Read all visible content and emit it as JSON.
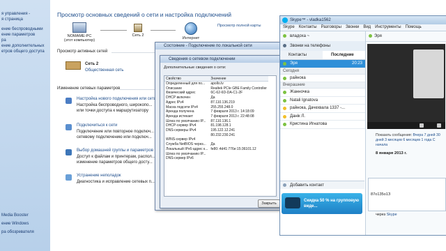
{
  "leftnav": {
    "items": [
      "я управления -",
      "я страница",
      "ение беспроводными",
      "ение параметров",
      "ра",
      "ение дополнительных",
      "етров общего доступа"
    ],
    "bottom": [
      "Media Booster",
      "ение Windows",
      "ра обозревателя"
    ]
  },
  "main": {
    "title": "Просмотр основных сведений о сети и настройка подключений",
    "view_full_map": "Просмотр полной карты",
    "nodes": [
      {
        "label": "NOMAME-PC",
        "sub": "(этот компьютер)"
      },
      {
        "label": "Сеть 2",
        "sub": ""
      },
      {
        "label": "Интернет",
        "sub": ""
      }
    ],
    "active_networks_title": "Просмотр активных сетей",
    "active_network": {
      "name": "Сеть 2",
      "type": "Общественная сеть"
    },
    "change_settings_title": "Изменение сетевых параметров",
    "settings": [
      {
        "link": "Настройка нового подключения или сети",
        "desc": "Настройка беспроводного, широкопо...",
        "desc2": "или точки доступа к маршрутизатору"
      },
      {
        "link": "Подключиться к сети",
        "desc": "Подключение или повторное подключ...",
        "desc2": "сетевому подключению или подключ..."
      },
      {
        "link": "Выбор домашней группы и параметров",
        "desc": "Доступ к файлам и принтерам, распол...",
        "desc2": "изменение параметров общего досту..."
      },
      {
        "link": "Устранение неполадок",
        "desc": "Диагностика и исправление сетевых п...",
        "desc2": ""
      }
    ]
  },
  "status_dlg": {
    "title": "Состояние - Подключение по локальной сети"
  },
  "details_dlg": {
    "title": "Сведения о сетевом подключении",
    "section": "Дополнительные сведения о сети:",
    "col_prop": "Свойство",
    "col_val": "Значение",
    "rows": [
      [
        "Определенный для по...",
        "apollo.lv"
      ],
      [
        "Описание",
        "Realtek PCIe GBE Family Controller"
      ],
      [
        "Физический адрес",
        "6C-62-6D-DA-C1-2F"
      ],
      [
        "DHCP включен",
        "Да"
      ],
      [
        "Адрес IPv4",
        "87.110.136.219"
      ],
      [
        "Маска подсети IPv4",
        "255.255.248.0"
      ],
      [
        "Аренда получена",
        "7 февраля 2013 г. 14:18:09"
      ],
      [
        "Аренда истекает",
        "7 февраля 2013 г. 22:48:08"
      ],
      [
        "Шлюз по умолчанию IP...",
        "87.110.136.1"
      ],
      [
        "DHCP-сервер IPv4",
        "81.198.128.1"
      ],
      [
        "DNS-серверы IPv4",
        "195.122.12.241"
      ],
      [
        "",
        "80.232.230.241"
      ],
      [
        "WINS-сервер IPv4",
        ""
      ],
      [
        "Служба NetBIOS через...",
        "Да"
      ],
      [
        "Локальный IPv6-адрес к...",
        "fe80::4d41:776e:15:36101.12"
      ],
      [
        "Шлюз по умолчанию IP...",
        ""
      ],
      [
        "DNS-сервер IPv6",
        ""
      ]
    ],
    "close_button": "Закрыть"
  },
  "skype": {
    "title": "Skype™ - vladka1562",
    "menu": [
      "Skype",
      "Контакты",
      "Разговоры",
      "Звонки",
      "Вид",
      "Инструменты",
      "Помощь"
    ],
    "user": "владоха ~",
    "call_phones": "Звонки на телефоны",
    "tab_contacts": "Контакты",
    "tab_recent": "Последние",
    "contacts": [
      {
        "name": "Эря",
        "time": "20:23",
        "selected": true,
        "color": "#7dc241"
      },
      {
        "group": "Сегодня"
      },
      {
        "name": "райнока",
        "color": "#7dc241"
      },
      {
        "group": "Вчерашние"
      },
      {
        "name": "Жанночка",
        "color": "#7dc241"
      },
      {
        "name": "Natali Ignatova",
        "color": "#7dc241"
      },
      {
        "name": "райнока, Дачкхвала 1337 -...",
        "color": "#f2c02b"
      },
      {
        "name": "Данік Л.",
        "color": "#f2c02b"
      },
      {
        "name": "Кристина Игнатова",
        "color": "#7dc241"
      }
    ],
    "add_contact": "Добавить контакт",
    "promo": "Скидка 50 % на групповую виде...",
    "chat_title": "Эря",
    "show_messages": "Показать сообщения:",
    "show_periods": [
      "Вчера",
      "7 дней",
      "30 дней",
      "3 месяцев",
      "6 месяцев",
      "1 года",
      "С начала"
    ],
    "date": "8 января 2013 г.",
    "input_value": "87о135о1З",
    "via": "через",
    "via_skype": "Skype"
  },
  "colors": {
    "accent": "#1f4e8c",
    "skype_selected": "#2f8fd8",
    "online": "#7dc241"
  }
}
